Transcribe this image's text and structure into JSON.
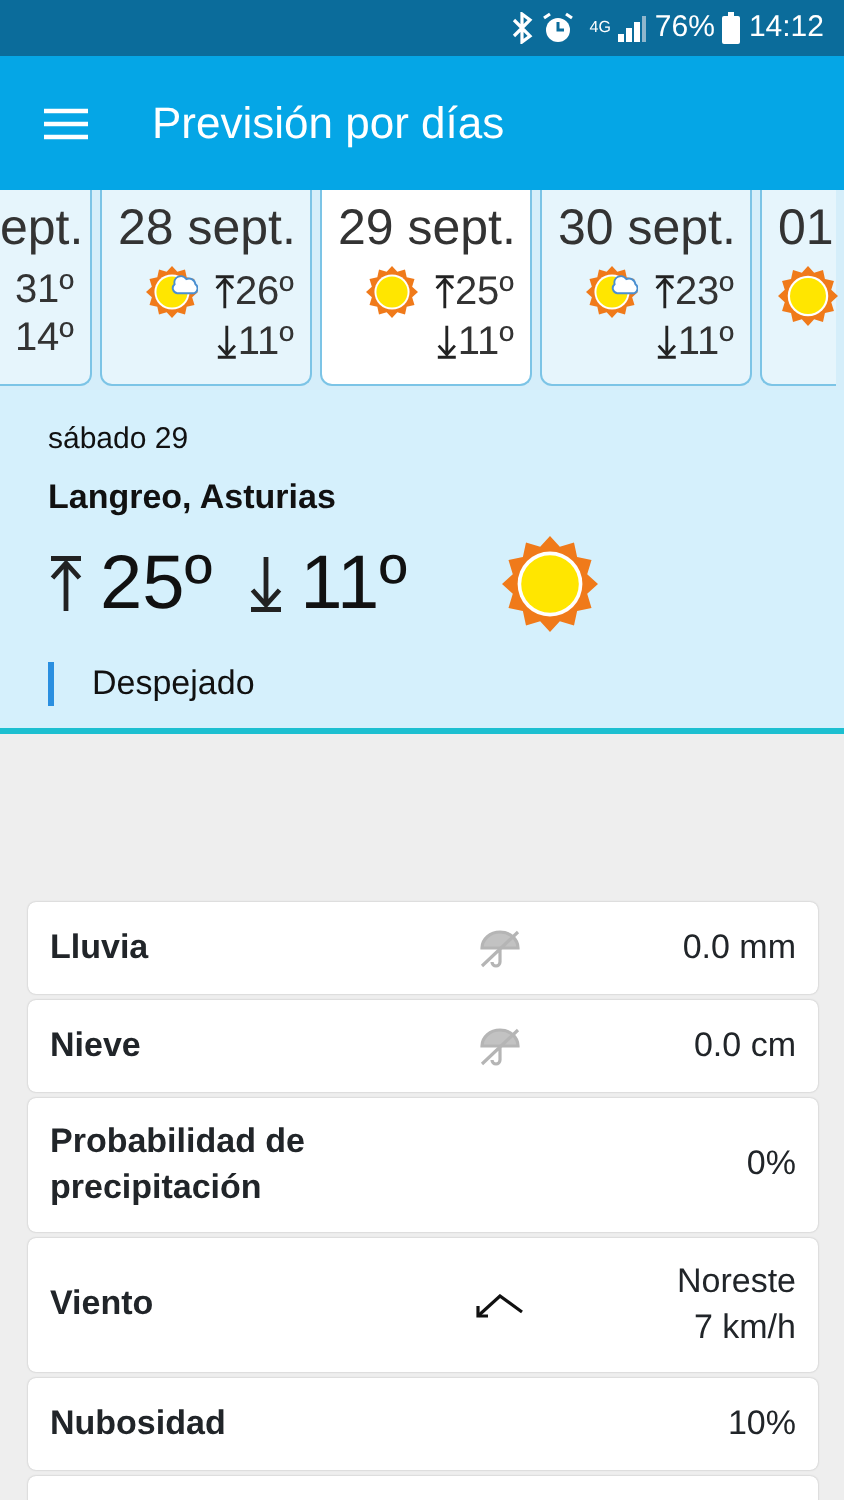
{
  "status_bar": {
    "network": "4G",
    "battery": "76%",
    "time": "14:12"
  },
  "app_bar": {
    "title": "Previsión por días"
  },
  "days": [
    {
      "date": "ept.",
      "max": "31º",
      "min": "14º",
      "selected": false
    },
    {
      "date": "28 sept.",
      "kind": "partly-cloudy",
      "max": "26º",
      "min": "11º",
      "selected": false
    },
    {
      "date": "29 sept.",
      "kind": "sunny",
      "max": "25º",
      "min": "11º",
      "selected": true
    },
    {
      "date": "30 sept.",
      "kind": "partly-cloudy",
      "max": "23º",
      "min": "11º",
      "selected": false
    },
    {
      "date": "01",
      "kind": "sunny",
      "selected": false
    }
  ],
  "detail": {
    "day": "sábado 29",
    "location": "Langreo, Asturias",
    "max": "25º",
    "min": "11º",
    "kind": "sunny",
    "sky": "Despejado"
  },
  "rows": [
    {
      "label": "Lluvia",
      "kind": "umbrella",
      "value": [
        "0.0 mm"
      ]
    },
    {
      "label": "Nieve",
      "kind": "umbrella",
      "value": [
        "0.0 cm"
      ]
    },
    {
      "label": "Probabilidad de precipitación",
      "kind": "plain",
      "value": [
        "0%"
      ]
    },
    {
      "label": "Viento",
      "kind": "wind",
      "value": [
        "Noreste",
        "7 km/h"
      ]
    },
    {
      "label": "Nubosidad",
      "kind": "plain",
      "value": [
        "10%"
      ]
    }
  ]
}
